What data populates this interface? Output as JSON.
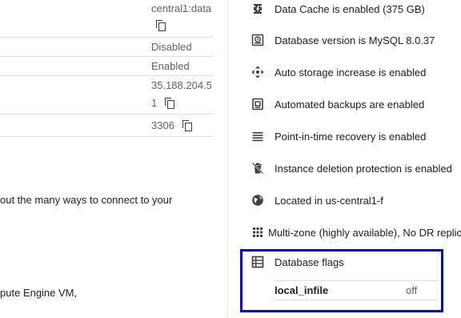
{
  "connections": {
    "connection_name_part": "central1:data",
    "public_ip_status": "Disabled",
    "private_ip_status": "Enabled",
    "ip_line1": "35.188.204.5",
    "ip_line2": "1",
    "port": "3306",
    "paragraph1": "out the many ways to connect to your",
    "paragraph2": "pute Engine VM,"
  },
  "config_items": [
    {
      "icon": "data-cache-icon",
      "label": "Data Cache is enabled (375 GB)"
    },
    {
      "icon": "database-version-icon",
      "label": "Database version is MySQL 8.0.37"
    },
    {
      "icon": "auto-storage-icon",
      "label": "Auto storage increase is enabled"
    },
    {
      "icon": "backup-icon",
      "label": "Automated backups are enabled"
    },
    {
      "icon": "list-icon",
      "label": "Point-in-time recovery is enabled"
    },
    {
      "icon": "delete-protection-icon",
      "label": "Instance deletion protection is enabled"
    },
    {
      "icon": "globe-icon",
      "label": "Located in us-central1-f"
    },
    {
      "icon": "grid-icon",
      "label": "Multi-zone (highly available), No DR replica c"
    }
  ],
  "database_flags": {
    "title": "Database flags",
    "flags": [
      {
        "name": "local_infile",
        "value": "off"
      }
    ]
  },
  "colors": {
    "highlight_box": "#0000cc"
  }
}
